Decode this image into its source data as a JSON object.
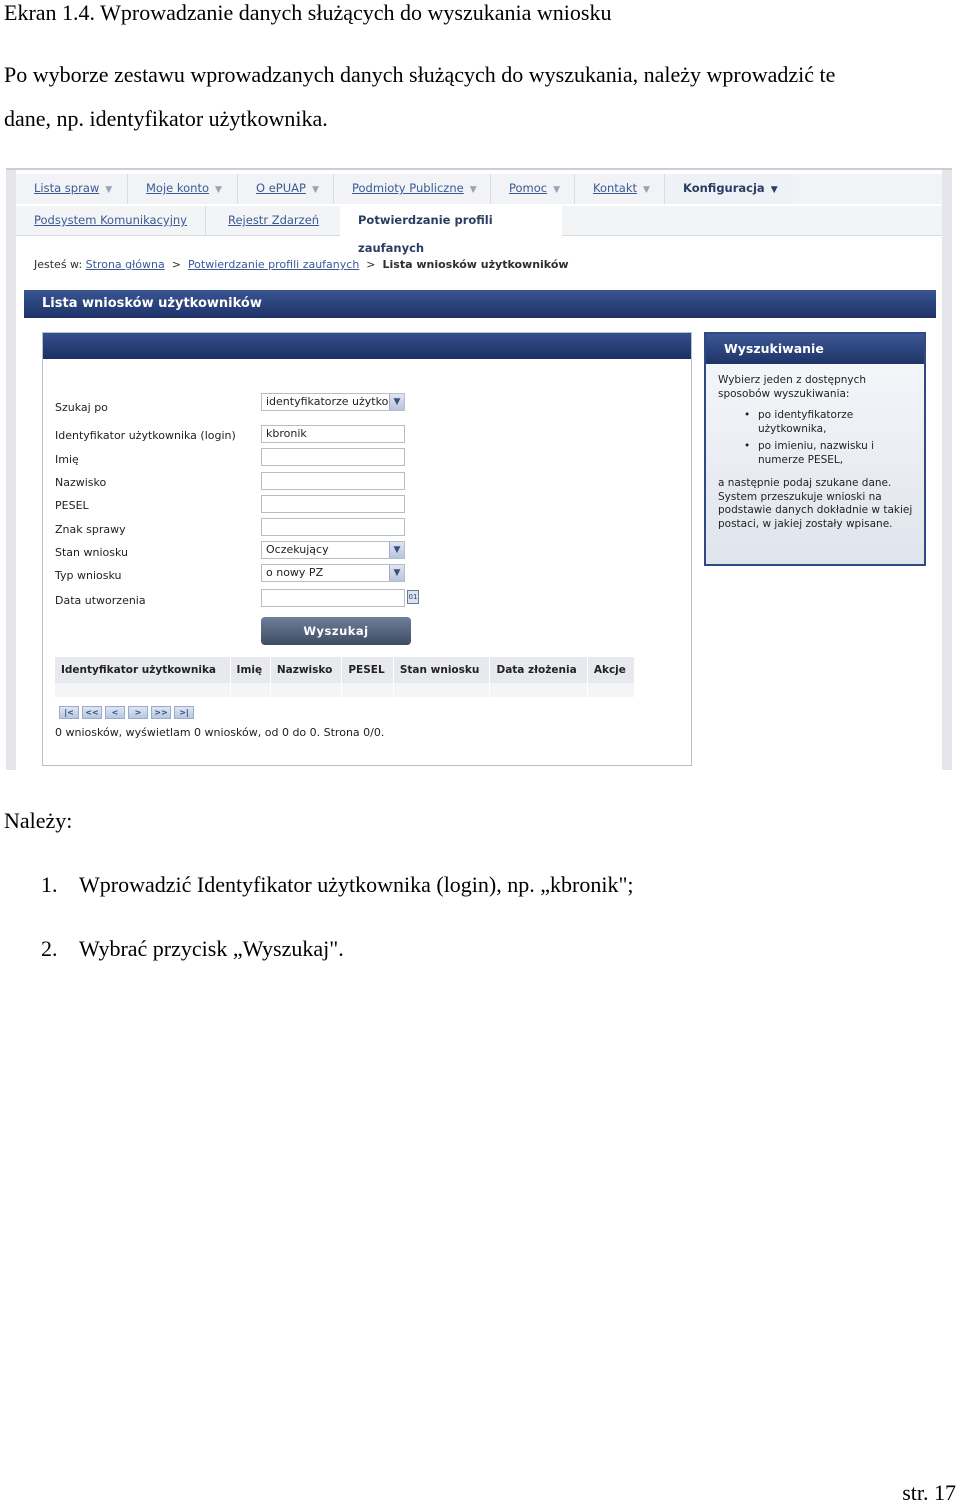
{
  "document": {
    "caption": "Ekran 1.4. Wprowadzanie danych służących do wyszukania wniosku",
    "intro_line1": "Po wyborze zestawu wprowadzanych danych służących do wyszukania, należy wprowadzić te",
    "intro_line2": "dane, np. identyfikator użytkownika.",
    "nalezy": "Należy:",
    "steps": [
      {
        "num": "1.",
        "text": "Wprowadzić Identyfikator użytkownika (login), np. „kbronik\";"
      },
      {
        "num": "2.",
        "text": "Wybrać przycisk „Wyszukaj\"."
      }
    ],
    "page_number": "str. 17"
  },
  "screenshot": {
    "topnav": [
      "Lista spraw",
      "Moje konto",
      "O ePUAP",
      "Podmioty Publiczne",
      "Pomoc",
      "Kontakt",
      "Konfiguracja"
    ],
    "subnav": [
      "Podsystem Komunikacyjny",
      "Rejestr Zdarzeń",
      "Potwierdzanie profili zaufanych"
    ],
    "breadcrumb": {
      "prefix": "Jesteś w:",
      "home": "Strona główna",
      "sep": ">",
      "section": "Potwierdzanie profili zaufanych",
      "current": "Lista wniosków użytkowników"
    },
    "page_title": "Lista wniosków użytkowników",
    "form": {
      "search_by_label": "Szukaj po",
      "search_by_value": "identyfikatorze użytkow",
      "login_label": "Identyfikator użytkownika (login)",
      "login_value": "kbronik",
      "first_name_label": "Imię",
      "last_name_label": "Nazwisko",
      "pesel_label": "PESEL",
      "case_mark_label": "Znak sprawy",
      "status_label": "Stan wniosku",
      "status_value": "Oczekujący",
      "type_label": "Typ wniosku",
      "type_value": "o nowy PZ",
      "created_label": "Data utworzenia",
      "search_button": "Wyszukaj"
    },
    "results": {
      "columns": [
        "Identyfikator użytkownika",
        "Imię",
        "Nazwisko",
        "PESEL",
        "Stan wniosku",
        "Data złożenia",
        "Akcje"
      ],
      "pager_info": "0 wniosków, wyświetlam 0 wniosków, od 0 do 0. Strona 0/0."
    },
    "side_panel": {
      "title": "Wyszukiwanie",
      "intro": "Wybierz jeden z dostępnych sposobów wyszukiwania:",
      "options": [
        "po identyfikatorze użytkownika,",
        "po imieniu, nazwisku i numerze PESEL,"
      ],
      "outro": "a następnie podaj szukane dane. System przeszukuje wnioski na podstawie danych dokładnie w takiej postaci, w jakiej zostały wpisane."
    },
    "colors": {
      "brand_dark_blue": "#1d3268",
      "link_blue": "#3a5a95"
    }
  }
}
